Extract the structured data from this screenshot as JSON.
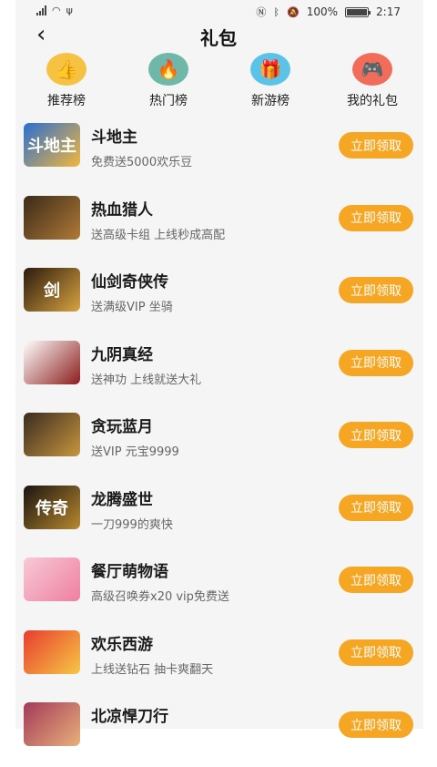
{
  "status_bar": {
    "time": "2:17",
    "battery": "100%",
    "battery_level": 1.0
  },
  "header": {
    "back_glyph": "‹",
    "title": "礼包"
  },
  "tabs": [
    {
      "label": "推荐榜",
      "icon": "thumbs-up-icon",
      "color": "#f5c242"
    },
    {
      "label": "热门榜",
      "icon": "campfire-icon",
      "color": "#6fb7a8"
    },
    {
      "label": "新游榜",
      "icon": "gift-box-icon",
      "color": "#5bc3e8"
    },
    {
      "label": "我的礼包",
      "icon": "gamepad-icon",
      "color": "#f26c5a"
    }
  ],
  "claim_label": "立即领取",
  "games": [
    {
      "name": "斗地主",
      "desc": "免费送5000欢乐豆",
      "thumb_text": "斗地主",
      "colors": [
        "#2a6fd1",
        "#f3b63b"
      ]
    },
    {
      "name": "热血猎人",
      "desc": "送高级卡组 上线秒成高配",
      "thumb_text": "",
      "colors": [
        "#3b2a1a",
        "#b07a36"
      ]
    },
    {
      "name": "仙剑奇侠传",
      "desc": "送满级VIP 坐骑",
      "thumb_text": "剑",
      "colors": [
        "#2b1a0d",
        "#d9a441"
      ]
    },
    {
      "name": "九阴真经",
      "desc": "送神功 上线就送大礼",
      "thumb_text": "",
      "colors": [
        "#ffffff",
        "#8c1c1c"
      ]
    },
    {
      "name": "贪玩蓝月",
      "desc": "送VIP 元宝9999",
      "thumb_text": "",
      "colors": [
        "#3a2b20",
        "#c8963e"
      ]
    },
    {
      "name": "龙腾盛世",
      "desc": "一刀999的爽快",
      "thumb_text": "传奇",
      "colors": [
        "#1a1410",
        "#b8892e"
      ]
    },
    {
      "name": "餐厅萌物语",
      "desc": "高级召唤券x20 vip免费送",
      "thumb_text": "",
      "colors": [
        "#f7c9d6",
        "#ef7fa1"
      ]
    },
    {
      "name": "欢乐西游",
      "desc": "上线送钻石 抽卡爽翻天",
      "thumb_text": "",
      "colors": [
        "#e83d2f",
        "#f7c745"
      ]
    },
    {
      "name": "北凉悍刀行",
      "desc": "",
      "thumb_text": "",
      "colors": [
        "#a33a5a",
        "#e9b07a"
      ]
    }
  ]
}
